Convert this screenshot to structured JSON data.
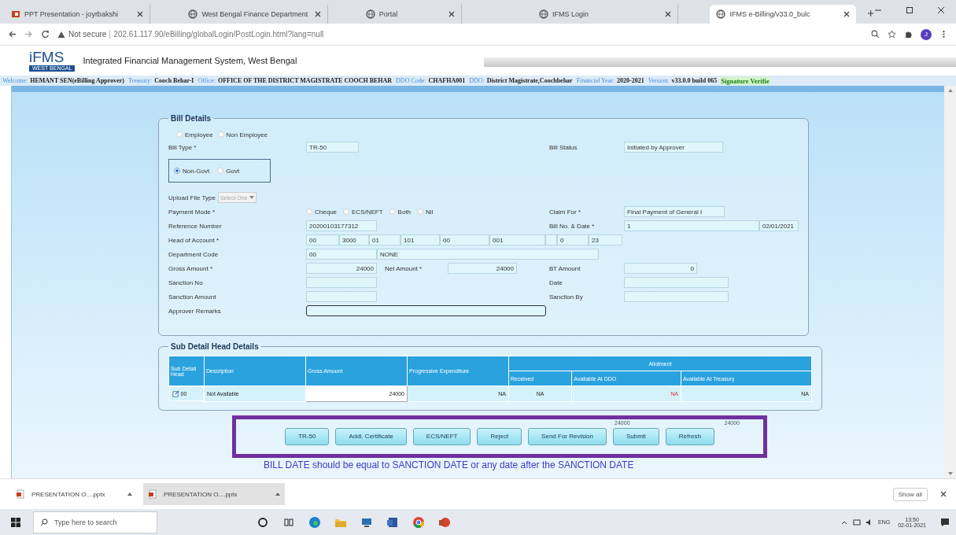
{
  "browser": {
    "tabs": [
      {
        "title": "PPT Presentation - joyrbakshi",
        "kind": "ppt",
        "selected": false
      },
      {
        "title": "West Bengal Finance Department",
        "kind": "web",
        "selected": false
      },
      {
        "title": "Portal",
        "kind": "web",
        "selected": false
      },
      {
        "title": "IFMS Login",
        "kind": "web",
        "selected": false
      },
      {
        "title": "IFMS e-Billing/v33.0_bulc",
        "kind": "web",
        "selected": true
      }
    ],
    "security": "Not secure",
    "url": "202.61.117.90/eBilling/globalLogin/PostLogin.html?lang=null",
    "profile": "J"
  },
  "header": {
    "logo": "iFMS",
    "logo_caption": "WEST BENGAL",
    "title": "Integrated Financial Management System, West Bengal"
  },
  "info_bar": {
    "items": [
      {
        "label": "Welcome:",
        "value": "HEMANT SEN(eBilling Approver)"
      },
      {
        "label": "Treasury:",
        "value": "Cooch Behar-I"
      },
      {
        "label": "Office:",
        "value": "OFFICE OF THE DISTRICT MAGISTRATE COOCH BEHAR"
      },
      {
        "label": "DDO Code:",
        "value": "CHAFHA001"
      },
      {
        "label": "DDO:",
        "value": "District Magistrate,Coochbehar"
      },
      {
        "label": "Financial Year:",
        "value": "2020-2021"
      },
      {
        "label": "Version:",
        "value": "v33.0.0 build 065"
      }
    ],
    "signature": "Signature Verifie"
  },
  "bill_details": {
    "legend": "Bill Details",
    "beneficiary": [
      {
        "label": "Employee",
        "selected": false
      },
      {
        "label": "Non Employee",
        "selected": false
      }
    ],
    "bill_type": {
      "label": "Bill Type *",
      "value": "TR-50"
    },
    "bill_status": {
      "label": "Bill Status",
      "value": "Initiated by Approver"
    },
    "govt_type": [
      {
        "label": "Non-Govt",
        "selected": true
      },
      {
        "label": "Govt",
        "selected": false
      }
    ],
    "upload_file_type": {
      "label": "Upload File Type",
      "value": "Select One",
      "disabled": true
    },
    "payment_mode": {
      "label": "Payment Mode *",
      "options": [
        {
          "label": "Cheque",
          "selected": false
        },
        {
          "label": "ECS/NEFT",
          "selected": false
        },
        {
          "label": "Both",
          "selected": false
        },
        {
          "label": "Nil",
          "selected": false
        }
      ]
    },
    "claim_for": {
      "label": "Claim For *",
      "value": "Final Payment of General I"
    },
    "reference_number": {
      "label": "Reference Number",
      "value": "20200103177312"
    },
    "bill_no_date": {
      "label": "Bill No. & Date *",
      "number": "1",
      "date": "02/01/2021"
    },
    "head_of_account": {
      "label": "Head of Account *",
      "segments": [
        "00",
        "3000",
        "01",
        "101",
        "00",
        "001",
        "0",
        "23"
      ]
    },
    "department_code": {
      "label": "Department Code",
      "code": "00",
      "name": "NONE"
    },
    "gross_amount": {
      "label": "Gross Amount *",
      "value": "24000"
    },
    "net_amount": {
      "label": "Net Amount *",
      "value": "24000"
    },
    "bt_amount": {
      "label": "BT Amount",
      "value": "0"
    },
    "sanction_no": {
      "label": "Sanction No"
    },
    "date": {
      "label": "Date"
    },
    "sanction_amount": {
      "label": "Sanction Amount"
    },
    "sanction_by": {
      "label": "Sanction By"
    },
    "approver_remarks": {
      "label": "Approver Remarks"
    }
  },
  "sub_detail": {
    "legend": "Sub Detail Head Details",
    "columns": [
      "Sub Detail Head",
      "Description",
      "Gross Amount",
      "Progressive Expenditure"
    ],
    "group": "Allotment",
    "group_columns": [
      "Received",
      "Available At DDO",
      "Available At Treasury"
    ],
    "rows": [
      {
        "head": "00",
        "description": "Not Available",
        "gross_amount": "24000",
        "progressive": "NA",
        "received": "NA",
        "available_ddo": "NA",
        "available_treasury": "NA"
      }
    ]
  },
  "totals": [
    "24000",
    "24000"
  ],
  "buttons": [
    "TR-50",
    "Addl. Certificate",
    "ECS/NEFT",
    "Reject",
    "Send For Revision",
    "Submit",
    "Refresh"
  ],
  "message": "BILL DATE should be equal to SANCTION DATE or any date after the SANCTION DATE",
  "downloads": {
    "items": [
      {
        "name": "PRESENTATION O....pptx"
      },
      {
        "name": "PRESENTATION O....pptx"
      }
    ],
    "show_all": "Show all"
  },
  "taskbar": {
    "search_placeholder": "Type here to search",
    "apps": [
      {
        "kind": "cortana"
      },
      {
        "kind": "taskview"
      },
      {
        "kind": "edge"
      },
      {
        "kind": "folder"
      },
      {
        "kind": "computer"
      },
      {
        "kind": "word"
      },
      {
        "kind": "chrome"
      },
      {
        "kind": "powerpoint"
      }
    ],
    "language": "ENG",
    "time": "13:50",
    "date": "02-01-2021"
  }
}
